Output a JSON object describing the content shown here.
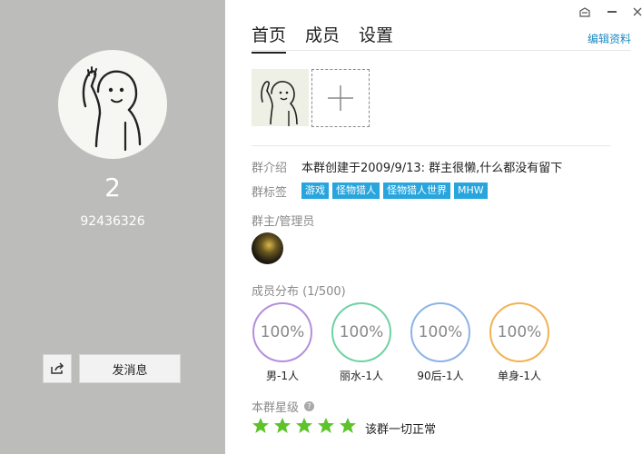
{
  "window": {
    "controls": [
      "skin-icon",
      "minimize-icon",
      "close-icon"
    ]
  },
  "profile": {
    "name": "2",
    "id": "92436326",
    "send_message_label": "发消息",
    "share_icon": "share-icon"
  },
  "tabs": [
    {
      "label": "首页",
      "active": true
    },
    {
      "label": "成员",
      "active": false
    },
    {
      "label": "设置",
      "active": false
    }
  ],
  "edit_label": "编辑资料",
  "intro": {
    "label": "群介绍",
    "text": "本群创建于2009/9/13:  群主很懒,什么都没有留下"
  },
  "tags": {
    "label": "群标签",
    "items": [
      "游戏",
      "怪物猎人",
      "怪物猎人世界",
      "MHW"
    ]
  },
  "admins": {
    "label": "群主/管理员"
  },
  "distribution": {
    "label": "成员分布 (1/500)",
    "items": [
      {
        "value": "100%",
        "label": "男-1人",
        "color": "#b48fdc"
      },
      {
        "value": "100%",
        "label": "丽水-1人",
        "color": "#6fd2a4"
      },
      {
        "value": "100%",
        "label": "90后-1人",
        "color": "#8db3e6"
      },
      {
        "value": "100%",
        "label": "单身-1人",
        "color": "#f2b255"
      }
    ]
  },
  "rating": {
    "label": "本群星级",
    "stars": 5,
    "star_color": "#5ec32a",
    "status": "该群一切正常"
  }
}
